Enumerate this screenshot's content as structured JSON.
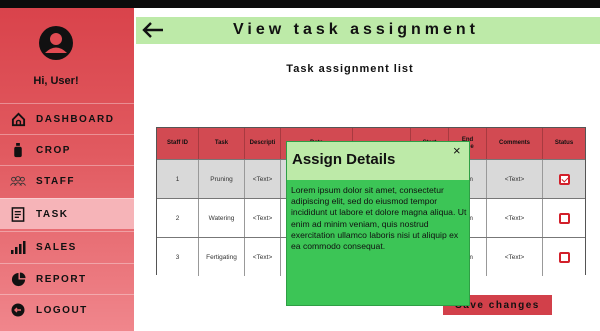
{
  "app": {
    "greeting": "Hi, User!",
    "header_title": "View task assignment",
    "list_title": "Task assignment list"
  },
  "sidebar": {
    "items": [
      {
        "label": "DASHBOARD",
        "icon": "home-icon"
      },
      {
        "label": "CROP",
        "icon": "crop-icon"
      },
      {
        "label": "STAFF",
        "icon": "staff-icon"
      },
      {
        "label": "TASK",
        "icon": "task-icon",
        "active": true
      },
      {
        "label": "SALES",
        "icon": "sales-icon"
      },
      {
        "label": "REPORT",
        "icon": "report-icon"
      },
      {
        "label": "LOGOUT",
        "icon": "logout-icon"
      }
    ]
  },
  "table": {
    "headers": [
      "Staff ID",
      "Task",
      "Descripti",
      "Date",
      "",
      "Start",
      "End\ntime",
      "Comments",
      "Status"
    ],
    "rows": [
      {
        "id": "1",
        "task": "Pruning",
        "desc": "<Text>",
        "end": "mm",
        "comments": "<Text>",
        "checked": true
      },
      {
        "id": "2",
        "task": "Watering",
        "desc": "<Text>",
        "end": "mm",
        "comments": "<Text>",
        "checked": false
      },
      {
        "id": "3",
        "task": "Fertigating",
        "desc": "<Text>",
        "end": "mm",
        "comments": "<Text>",
        "checked": false
      }
    ]
  },
  "buttons": {
    "save_label": "Save changes"
  },
  "modal": {
    "title": "Assign Details",
    "close": "×",
    "body": "Lorem ipsum dolor sit amet, consectetur adipiscing elit, sed do eiusmod tempor incididunt ut labore et dolore magna aliqua. Ut enim ad minim veniam, quis nostrud exercitation ullamco laboris nisi ut aliquip ex ea commodo consequat."
  },
  "colors": {
    "sidebar": "#d9434b",
    "header": "#bdeaa8",
    "table_head": "#d24a52",
    "modal": "#3cc556",
    "checkbox": "#d21f2a"
  }
}
